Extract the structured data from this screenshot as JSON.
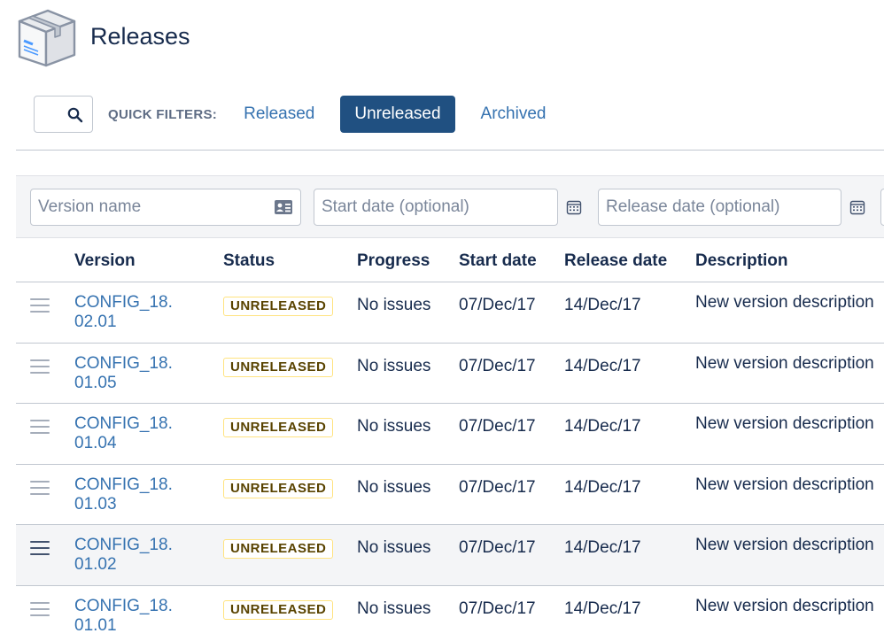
{
  "page": {
    "title": "Releases",
    "icon": "box-icon"
  },
  "filters": {
    "search_icon": "search-icon",
    "label": "QUICK FILTERS:",
    "items": [
      {
        "label": "Released",
        "active": false
      },
      {
        "label": "Unreleased",
        "active": true
      },
      {
        "label": "Archived",
        "active": false
      }
    ]
  },
  "create_form": {
    "version_placeholder": "Version name",
    "start_placeholder": "Start date (optional)",
    "release_placeholder": "Release date (optional)"
  },
  "table": {
    "columns": [
      "Version",
      "Status",
      "Progress",
      "Start date",
      "Release date",
      "Description"
    ],
    "rows": [
      {
        "version_line1": "CONFIG_18.",
        "version_line2": "02.01",
        "status": "UNRELEASED",
        "progress": "No issues",
        "start": "07/Dec/17",
        "release": "14/Dec/17",
        "description": "New version description"
      },
      {
        "version_line1": "CONFIG_18.",
        "version_line2": "01.05",
        "status": "UNRELEASED",
        "progress": "No issues",
        "start": "07/Dec/17",
        "release": "14/Dec/17",
        "description": "New version description"
      },
      {
        "version_line1": "CONFIG_18.",
        "version_line2": "01.04",
        "status": "UNRELEASED",
        "progress": "No issues",
        "start": "07/Dec/17",
        "release": "14/Dec/17",
        "description": "New version description"
      },
      {
        "version_line1": "CONFIG_18.",
        "version_line2": "01.03",
        "status": "UNRELEASED",
        "progress": "No issues",
        "start": "07/Dec/17",
        "release": "14/Dec/17",
        "description": "New version description"
      },
      {
        "version_line1": "CONFIG_18.",
        "version_line2": "01.02",
        "status": "UNRELEASED",
        "progress": "No issues",
        "start": "07/Dec/17",
        "release": "14/Dec/17",
        "description": "New version description"
      },
      {
        "version_line1": "CONFIG_18.",
        "version_line2": "01.01",
        "status": "UNRELEASED",
        "progress": "No issues",
        "start": "07/Dec/17",
        "release": "14/Dec/17",
        "description": "New version description"
      }
    ]
  },
  "colors": {
    "link": "#3572b0",
    "primary_button": "#205081",
    "lozenge_border": "#ffe380",
    "lozenge_text": "#594300"
  }
}
